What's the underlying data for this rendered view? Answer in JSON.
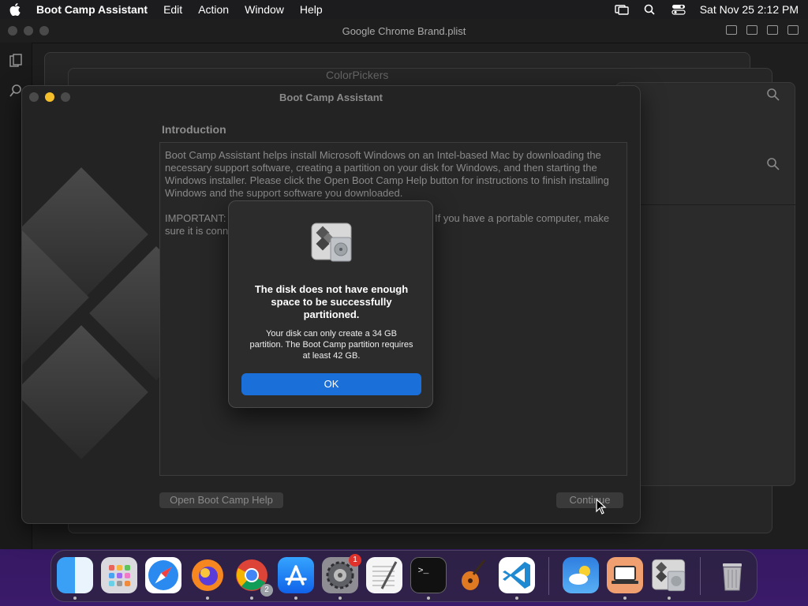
{
  "menubar": {
    "app_name": "Boot Camp Assistant",
    "items": [
      "Edit",
      "Action",
      "Window",
      "Help"
    ],
    "datetime": "Sat Nov 25  2:12 PM"
  },
  "background_window": {
    "title": "Google Chrome Brand.plist",
    "partial_label": "ColorPickers"
  },
  "bootcamp": {
    "title": "Boot Camp Assistant",
    "intro_heading": "Introduction",
    "paragraph1": "Boot Camp Assistant helps install Microsoft Windows on an Intel-based Mac by downloading the necessary support software, creating a partition on your disk for Windows, and then starting the Windows installer. Please click the Open Boot Camp Help button for instructions to finish installing Windows and the support software you downloaded.",
    "paragraph2": "IMPORTANT: Back up your disk before installing Windows. If you have a portable computer, make sure it is connected.",
    "help_button": "Open Boot Camp Help",
    "continue_button": "Continue"
  },
  "alert": {
    "title": "The disk does not have enough space to be successfully partitioned.",
    "message": "Your disk can only create a 34 GB partition. The Boot Camp partition requires at least 42 GB.",
    "ok_button": "OK"
  },
  "dock": {
    "apps": [
      {
        "name": "Finder",
        "icon": "finder-icon"
      },
      {
        "name": "Launchpad",
        "icon": "launchpad-icon"
      },
      {
        "name": "Safari",
        "icon": "safari-icon"
      },
      {
        "name": "Firefox",
        "icon": "firefox-icon"
      },
      {
        "name": "Google Chrome",
        "icon": "chrome-icon",
        "badge": "2"
      },
      {
        "name": "App Store",
        "icon": "app-store-icon"
      },
      {
        "name": "System Settings",
        "icon": "system-settings-icon",
        "badge": "1"
      },
      {
        "name": "TextEdit",
        "icon": "textedit-icon"
      },
      {
        "name": "Terminal",
        "icon": "terminal-icon"
      },
      {
        "name": "GarageBand",
        "icon": "garageband-icon"
      },
      {
        "name": "Visual Studio Code",
        "icon": "vscode-icon"
      },
      {
        "name": "Weather",
        "icon": "weather-icon"
      },
      {
        "name": "Screen Sharing",
        "icon": "screen-icon"
      },
      {
        "name": "Boot Camp Assistant",
        "icon": "bootcamp-icon"
      },
      {
        "name": "Trash",
        "icon": "trash-icon"
      }
    ]
  }
}
